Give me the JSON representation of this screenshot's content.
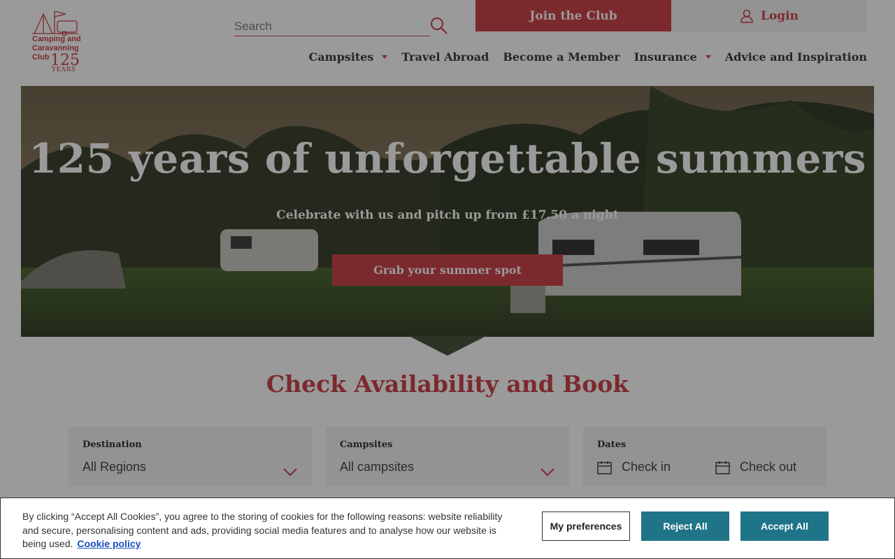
{
  "logo": {
    "text": "Camping and Caravanning Club",
    "anniversary": "125",
    "years": "YEARS"
  },
  "search": {
    "placeholder": "Search"
  },
  "header": {
    "join_label": "Join the Club",
    "login_label": "Login"
  },
  "nav": {
    "items": [
      {
        "label": "Campsites",
        "has_dropdown": true
      },
      {
        "label": "Travel Abroad",
        "has_dropdown": false
      },
      {
        "label": "Become a Member",
        "has_dropdown": false
      },
      {
        "label": "Insurance",
        "has_dropdown": true
      },
      {
        "label": "Advice and Inspiration",
        "has_dropdown": false
      }
    ]
  },
  "hero": {
    "title": "125 years of unforgettable summers",
    "subtitle": "Celebrate with us and pitch up from £17.50 a night",
    "cta": "Grab your summer spot"
  },
  "booking": {
    "title": "Check Availability and Book",
    "destination": {
      "label": "Destination",
      "value": "All Regions"
    },
    "campsites": {
      "label": "Campsites",
      "value": "All campsites"
    },
    "dates": {
      "label": "Dates",
      "check_in": "Check in",
      "check_out": "Check out"
    }
  },
  "cookie": {
    "text": "By clicking “Accept All Cookies”, you agree to the storing of cookies for the following reasons: website reliability and secure, personalising content and ads, providing social media features and to analyse how our website is being used.",
    "link": "Cookie policy",
    "preferences": "My preferences",
    "reject": "Reject All",
    "accept": "Accept All"
  },
  "colors": {
    "brand_red": "#c8323b",
    "cookie_teal": "#1f7488"
  }
}
